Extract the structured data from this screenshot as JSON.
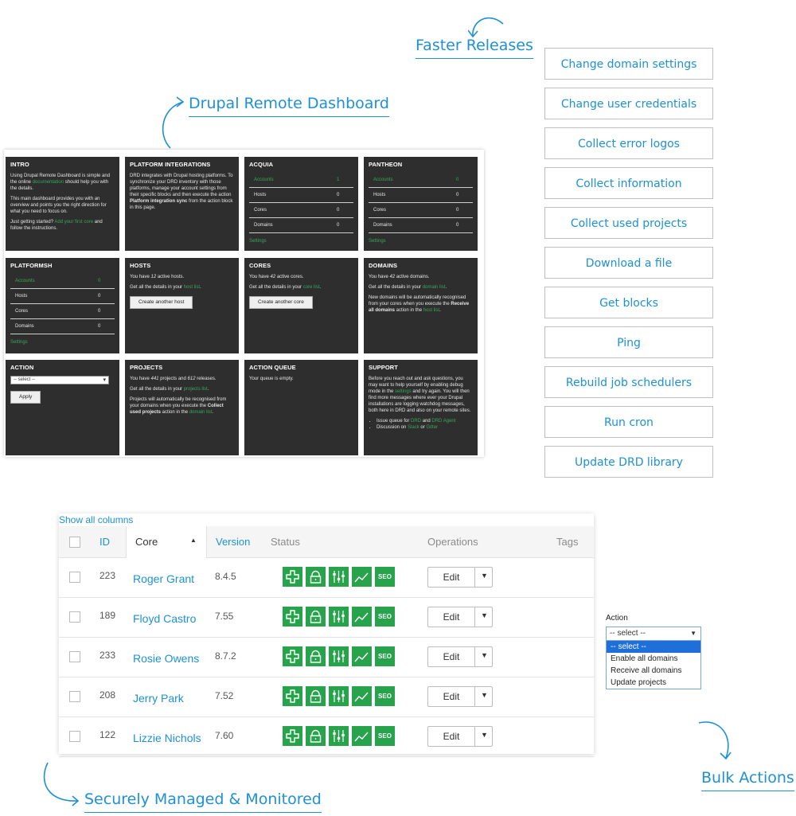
{
  "callouts": {
    "faster_releases": "Faster Releases",
    "drupal_remote_dashboard": "Drupal Remote Dashboard",
    "securely_managed": "Securely Managed & Monitored",
    "bulk_actions": "Bulk Actions"
  },
  "actions": [
    "Change domain settings",
    "Change user credentials",
    "Collect error logos",
    "Collect information",
    "Collect used projects",
    "Download a file",
    "Get blocks",
    "Ping",
    "Rebuild job schedulers",
    "Run cron",
    "Update DRD library"
  ],
  "dashboard": {
    "intro": {
      "title": "INTRO",
      "p1a": "Using Drupal Remote Dashboard is simple and the online ",
      "p1link": "documentation",
      "p1b": " should help you with the details.",
      "p2": "This main dashboard provides you with an overview and points you the right direction for what you need to focus on.",
      "p3a": "Just getting started? ",
      "p3link": "Add your first core",
      "p3b": " and follow the instructions."
    },
    "platform": {
      "title": "PLATFORM INTEGRATIONS",
      "p1": "DRD integrates with Drupal hosting platforms. To synchronize your DRD inventory with those platforms, manage your account settings from their specific blocks and then execute the action ",
      "p1bold": "Platform integration sync",
      "p1b": " from the action block in this page."
    },
    "acquia": {
      "title": "ACQUIA",
      "rows": [
        [
          "Accounts",
          "1"
        ],
        [
          "Hosts",
          "0"
        ],
        [
          "Cores",
          "0"
        ],
        [
          "Domains",
          "0"
        ]
      ],
      "settings": "Settings"
    },
    "pantheon": {
      "title": "PANTHEON",
      "rows": [
        [
          "Accounts",
          "0"
        ],
        [
          "Hosts",
          "0"
        ],
        [
          "Cores",
          "0"
        ],
        [
          "Domains",
          "0"
        ]
      ],
      "settings": "Settings"
    },
    "platformsh": {
      "title": "PLATFORMSH",
      "rows": [
        [
          "Accounts",
          "0"
        ],
        [
          "Hosts",
          "0"
        ],
        [
          "Cores",
          "0"
        ],
        [
          "Domains",
          "0"
        ]
      ],
      "settings": "Settings"
    },
    "hosts": {
      "title": "HOSTS",
      "p1a": "You have ",
      "count": "12",
      "p1b": " active hosts.",
      "p2a": "Get all the details in your ",
      "p2link": "host list",
      "p2b": ".",
      "button": "Create another host"
    },
    "cores": {
      "title": "CORES",
      "p1a": "You have ",
      "count": "42",
      "p1b": " active cores.",
      "p2a": "Get all the details in your ",
      "p2link": "core list",
      "p2b": ".",
      "button": "Create another core"
    },
    "domains": {
      "title": "DOMAINS",
      "p1a": "You have ",
      "count": "42",
      "p1b": " active domains.",
      "p2a": "Get all the details in your ",
      "p2link": "domain list",
      "p2b": ".",
      "p3": "New domains will be automatically recognised from your cores when you execute the ",
      "p3bold": "Receive all domains",
      "p3b": " action in the ",
      "p3link": "host list",
      "p3c": "."
    },
    "action": {
      "title": "ACTION",
      "select": "-- select --",
      "button": "Apply"
    },
    "projects": {
      "title": "PROJECTS",
      "p1a": "You have ",
      "count1": "441",
      "p1b": " projects and ",
      "count2": "612",
      "p1c": " releases.",
      "p2a": "Get all the details in your ",
      "p2link": "projects list",
      "p2b": ".",
      "p3": "Projects will automatically be recognised from your domains when you execute the ",
      "p3bold": "Collect used projects",
      "p3b": " action in the ",
      "p3link": "domain list",
      "p3c": "."
    },
    "queue": {
      "title": "ACTION QUEUE",
      "p1": "Your queue is empty."
    },
    "support": {
      "title": "SUPPORT",
      "p1a": "Before you reach out and ask questions, you may want to help yourself by enabling debug mode in the ",
      "p1link": "settings",
      "p1b": " and try again. You will then find more messages where ever your Drupal installations are logging watchdog messages, both here in DRD and also on your remote sites.",
      "li1a": "Issue queue for ",
      "li1l1": "DRD",
      "li1b": " and ",
      "li1l2": "DRD Agent",
      "li2a": "Discussion on ",
      "li2l1": "Slack",
      "li2b": " or ",
      "li2l2": "Gitter"
    }
  },
  "table": {
    "show_all_columns": "Show all columns",
    "headers": {
      "id": "ID",
      "core": "Core",
      "sort_icon": "▲",
      "version": "Version",
      "status": "Status",
      "operations": "Operations",
      "tags": "Tags"
    },
    "rows": [
      {
        "id": "223",
        "name": "Roger Grant",
        "version": "8.4.5"
      },
      {
        "id": "189",
        "name": "Floyd Castro",
        "version": "7.55"
      },
      {
        "id": "233",
        "name": "Rosie Owens",
        "version": "8.7.2"
      },
      {
        "id": "208",
        "name": "Jerry Park",
        "version": "7.52"
      },
      {
        "id": "122",
        "name": "Lizzie Nichols",
        "version": "7.60"
      }
    ],
    "edit_label": "Edit",
    "seo_label": "SEO",
    "status_icons": [
      "plus-icon",
      "lock-icon",
      "sliders-icon",
      "trend-icon",
      "seo-icon"
    ]
  },
  "bulk": {
    "label": "Action",
    "selected": "-- select --",
    "options": [
      "-- select --",
      "Enable all domains",
      "Receive all domains",
      "Update projects"
    ]
  },
  "colors": {
    "accent": "#1e90d6",
    "tile_bg": "#2e2e2e",
    "status_green": "#27a34c"
  }
}
